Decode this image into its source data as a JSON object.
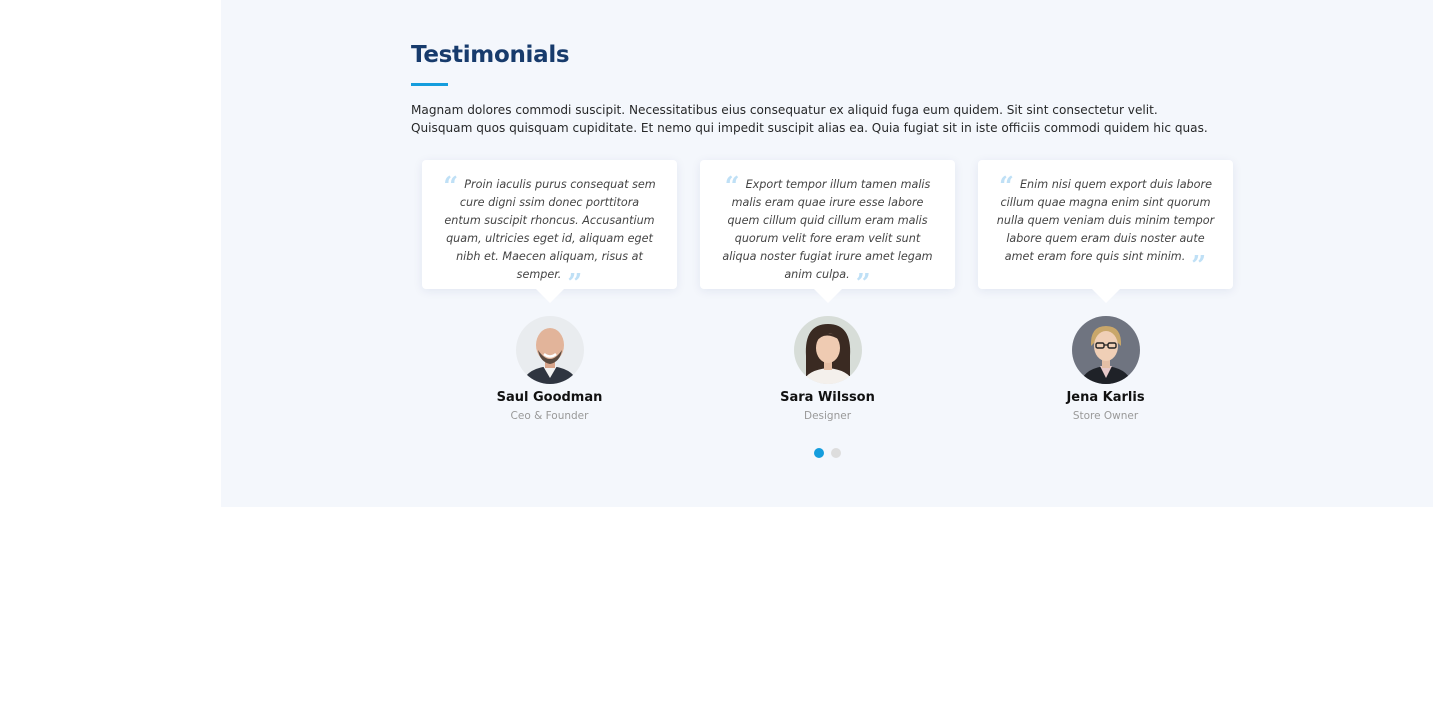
{
  "section": {
    "title": "Testimonials",
    "description": "Magnam dolores commodi suscipit. Necessitatibus eius consequatur ex aliquid fuga eum quidem. Sit sint consectetur velit. Quisquam quos quisquam cupiditate. Et nemo qui impedit suscipit alias ea. Quia fugiat sit in iste officiis commodi quidem hic quas.",
    "accent_color": "#149ddd",
    "heading_color": "#173b6c",
    "background_color": "#f4f7fc"
  },
  "testimonials": [
    {
      "quote": "Proin iaculis purus consequat sem cure digni ssim donec porttitora entum suscipit rhoncus. Accusantium quam, ultricies eget id, aliquam eget nibh et. Maecen aliquam, risus at semper.",
      "name": "Saul Goodman",
      "role": "Ceo & Founder",
      "avatar": "bald-smiling-man-photo"
    },
    {
      "quote": "Export tempor illum tamen malis malis eram quae irure esse labore quem cillum quid cillum eram malis quorum velit fore eram velit sunt aliqua noster fugiat irure amet legam anim culpa.",
      "name": "Sara Wilsson",
      "role": "Designer",
      "avatar": "woman-dark-hair-photo"
    },
    {
      "quote": "Enim nisi quem export duis labore cillum quae magna enim sint quorum nulla quem veniam duis minim tempor labore quem eram duis noster aute amet eram fore quis sint minim.",
      "name": "Jena Karlis",
      "role": "Store Owner",
      "avatar": "blonde-woman-glasses-photo"
    }
  ],
  "quote_icons": {
    "open": "“",
    "close": "”"
  },
  "pagination": {
    "pages": 2,
    "active_page": 1
  }
}
